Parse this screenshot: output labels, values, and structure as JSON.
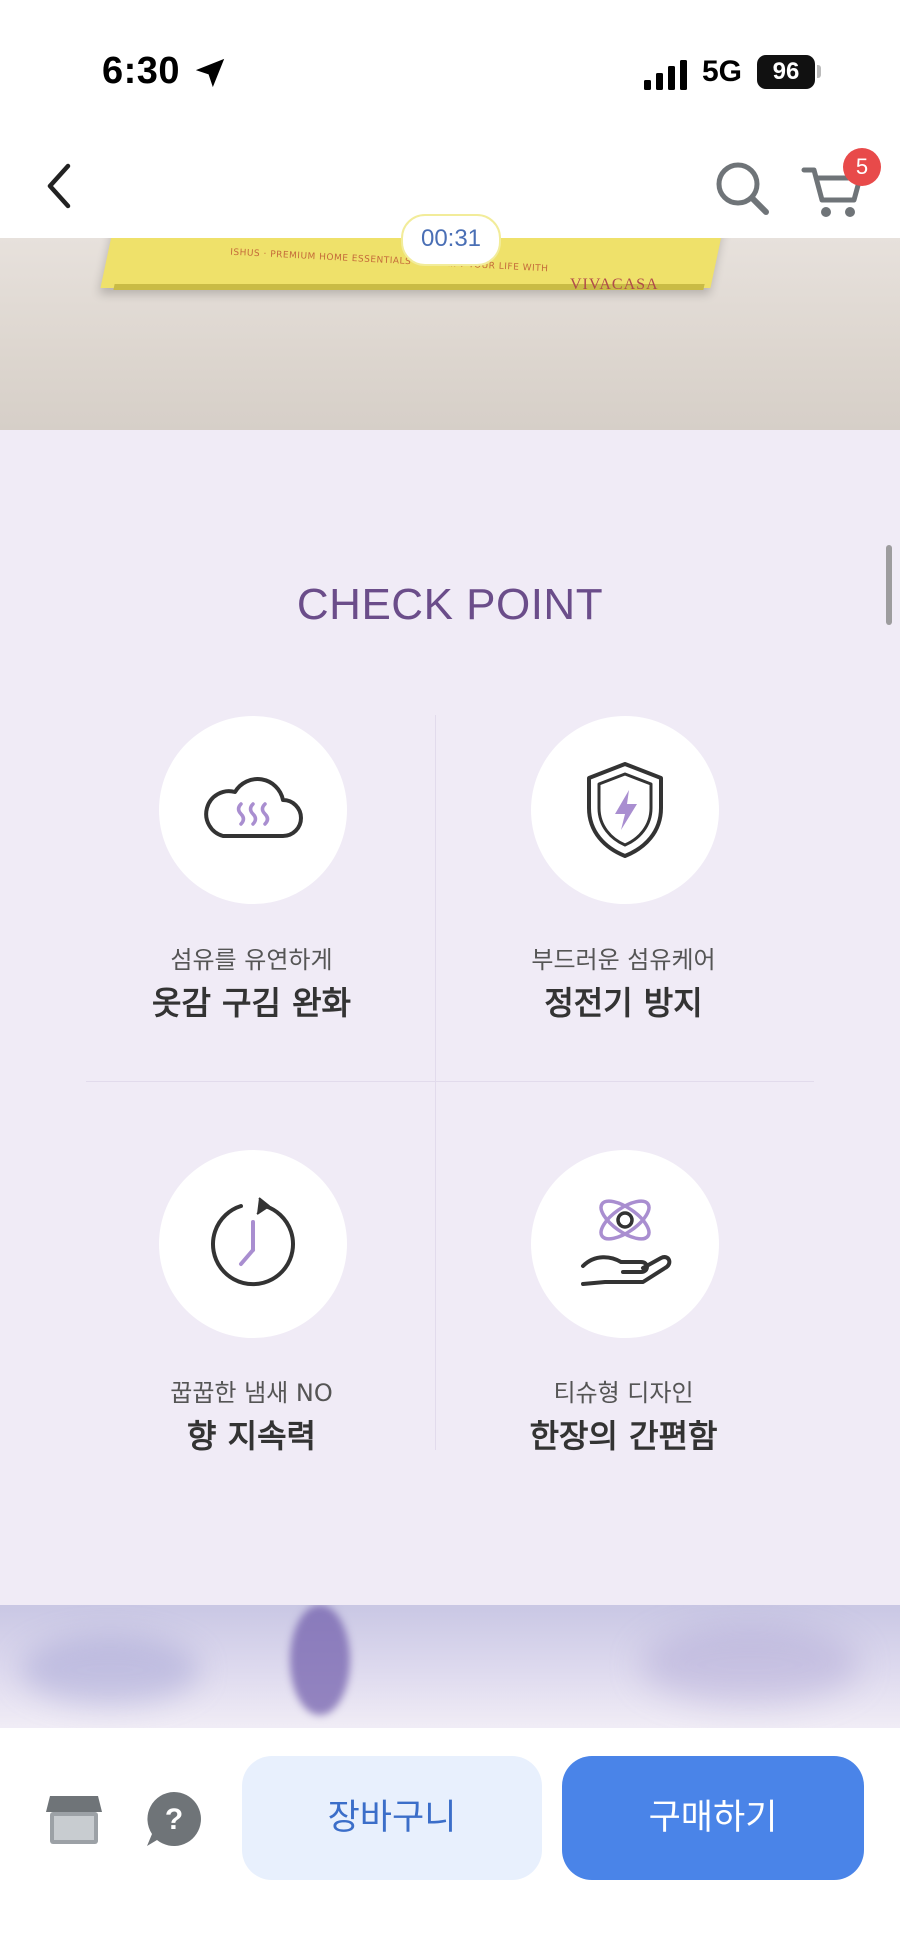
{
  "status_bar": {
    "time": "6:30",
    "network": "5G",
    "battery": "96"
  },
  "nav": {
    "cart_count": "5",
    "icons": [
      "back-icon",
      "search-icon",
      "cart-icon"
    ]
  },
  "hero": {
    "timer": "00:31",
    "box_text": "ISHUS · PREMIUM HOME ESSENTIALS · SIMPLIFY YOUR LIFE WITH",
    "box_brand": "VIVACASA"
  },
  "check_point": {
    "title": "CHECK POINT",
    "items": [
      {
        "icon": "cloud-steam-icon",
        "subtitle": "섬유를 유연하게",
        "title": "옷감 구김 완화"
      },
      {
        "icon": "shield-lightning-icon",
        "subtitle": "부드러운 섬유케어",
        "title": "정전기 방지"
      },
      {
        "icon": "clock-icon",
        "subtitle": "꿉꿉한 냄새 NO",
        "title": "향 지속력"
      },
      {
        "icon": "hand-atom-icon",
        "subtitle": "티슈형 디자인",
        "title": "한장의 간편함"
      }
    ]
  },
  "bottom_bar": {
    "cart_label": "장바구니",
    "buy_label": "구매하기",
    "icons": [
      "store-icon",
      "question-icon"
    ]
  },
  "colors": {
    "accent": "#4a84e8",
    "title_purple": "#6b4d8a",
    "section_bg": "#f0ebf6",
    "badge": "#e84a4a"
  }
}
